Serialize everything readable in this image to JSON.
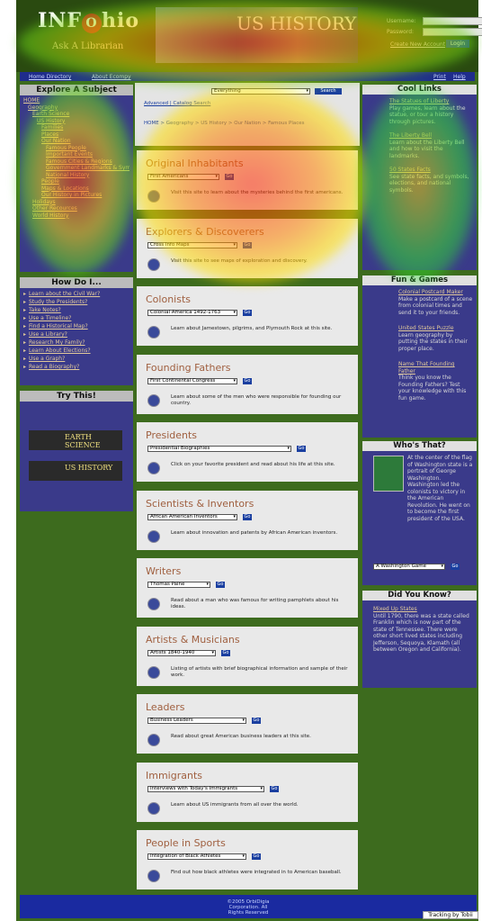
{
  "header": {
    "logo_prefix": "INF",
    "logo_o": "O",
    "logo_suffix": "hio",
    "tagline": "Ask A Librarian",
    "title": "US HISTORY",
    "username_label": "Username:",
    "password_label": "Password:",
    "signup": "Create New Account",
    "login": "Login"
  },
  "navbar": {
    "left1": "Home Directory",
    "left2": "About Ecompy",
    "right1": "Print",
    "right2": "Help"
  },
  "explore": {
    "heading": "Explore A Subject",
    "tree": [
      "HOME",
      "Geography",
      "Earth Science",
      "US History",
      "Families",
      "Places",
      "Our Nation",
      "Famous People",
      "Important Events",
      "Famous Cities & Regions",
      "Government Landmarks & Symbols",
      "National History",
      "People",
      "Maps & Locations",
      "Our History in Pictures",
      "Holidays",
      "Other Recources",
      "World History"
    ]
  },
  "howdo": {
    "heading": "How Do I...",
    "links": [
      "Learn about the Civil War?",
      "Study the Presidents?",
      "Take Notes?",
      "Use a Timeline?",
      "Find a Historical Map?",
      "Use a Library?",
      "Research My Family?",
      "Learn About Elections?",
      "Use a Graph?",
      "Read a Biography?"
    ]
  },
  "trythis": {
    "heading": "Try This!",
    "banner1": "EARTH SCIENCE",
    "banner2": "US HISTORY"
  },
  "search": {
    "select": "Everything",
    "button": "Search",
    "links": "Advanced | Catalog Search",
    "breadcrumb": "HOME > Geography > US History > Our Nation > Famous Places"
  },
  "cards": [
    {
      "title": "Original Inhabitants",
      "select": "First Americans",
      "desc": "Visit this site to learn about the mysteries behind the first americans."
    },
    {
      "title": "Explorers & Discoverers",
      "select": "Cross Info Maps",
      "desc": "Visit this site to see maps of exploration and discovery."
    },
    {
      "title": "Colonists",
      "select": "Colonial America 1492-1763",
      "desc": "Learn about Jamestown, pilgrims, and Plymouth Rock at this site."
    },
    {
      "title": "Founding Fathers",
      "select": "First Continental Congress",
      "desc": "Learn about some of the men who were responsible for founding our country."
    },
    {
      "title": "Presidents",
      "select": "Presidential Biographies",
      "desc": "Click on your favorite president and read about his life at this site."
    },
    {
      "title": "Scientists & Inventors",
      "select": "African American Inventors",
      "desc": "Learn about innovation and patents by African American inventors."
    },
    {
      "title": "Writers",
      "select": "Thomas Paine",
      "desc": "Read about a man who was famous for writing pamphlets about his ideas."
    },
    {
      "title": "Artists & Musicians",
      "select": "Artists 1840-1940",
      "desc": "Listing of artists with brief biographical information and sample of their work."
    },
    {
      "title": "Leaders",
      "select": "Business Leaders",
      "desc": "Read about great American business leaders at this site."
    },
    {
      "title": "Immigrants",
      "select": "Interviews with Today's Immigrants",
      "desc": "Learn about US immigrants from all over the world."
    },
    {
      "title": "People in Sports",
      "select": "Integration of Black Athletes",
      "desc": "Find out how black athletes were integrated in to American baseball."
    }
  ],
  "go": "Go",
  "coollinks": {
    "heading": "Cool Links",
    "items": [
      {
        "link": "The Statues of Liberty",
        "text": "Play games, learn about the statue, or tour a history through pictures."
      },
      {
        "link": "The Liberty Bell",
        "text": "Learn about the Liberty Bell and how to visit the landmarks."
      },
      {
        "link": "50 States Facts",
        "text": "See state facts, and symbols, elections, and national symbols."
      }
    ]
  },
  "fungames": {
    "heading": "Fun & Games",
    "items": [
      {
        "link": "Colonial Postcard Maker",
        "text": "Make a postcard of a scene from colonial times and send it to your friends."
      },
      {
        "link": "United States Puzzle",
        "text": "Learn geography by putting the states in their proper place."
      },
      {
        "link": "Name That Founding Father",
        "text": "Think you know the Founding Fathers? Test your knowledge with this fun game."
      }
    ]
  },
  "whosthat": {
    "heading": "Who's That?",
    "text": "At the center of the flag of Washington state is a portrait of George Washington. Washington led the colonists to victory in the American Revolution. He went on to become the first president of the USA.",
    "select": "A Washington Game"
  },
  "didyouknow": {
    "heading": "Did You Know?",
    "link": "Mixed Up States",
    "text": "Until 1790, there was a state called Franklin which is now part of the state of Tennessee. There were other short lived states including Jefferson, Sequoya, Klamath (all between Oregon and California)."
  },
  "footer": {
    "line1": "©2005 OrbiDigia",
    "line2": "Corporation. All",
    "line3": "Rights Reserved"
  },
  "tobii": "Tracking by Tobii"
}
